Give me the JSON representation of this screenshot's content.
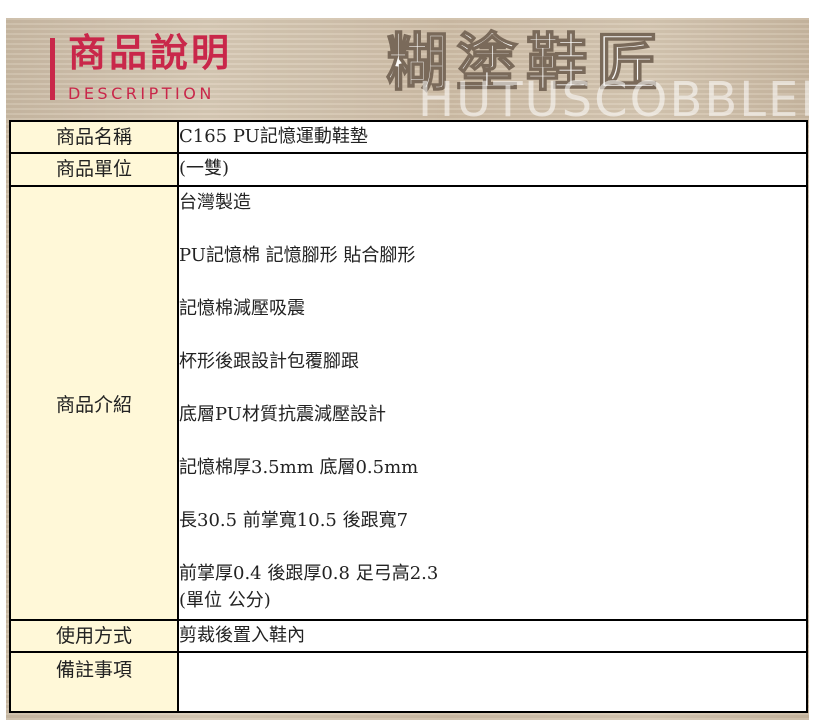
{
  "header": {
    "title_cn": "商品說明",
    "title_en": "DESCRIPTION",
    "brand_cn": "糊塗鞋匠",
    "brand_en": "HUTUSCOBBLER"
  },
  "table": {
    "rows": [
      {
        "label": "商品名稱",
        "value": "C165 PU記憶運動鞋墊"
      },
      {
        "label": "商品單位",
        "value": "(一雙)"
      },
      {
        "label": "商品介紹",
        "lines": [
          "台灣製造",
          "PU記憶棉 記憶腳形 貼合腳形",
          "記憶棉減壓吸震",
          "杯形後跟設計包覆腳跟",
          "底層PU材質抗震減壓設計",
          "記憶棉厚3.5mm 底層0.5mm",
          "長30.5 前掌寬10.5 後跟寬7",
          "前掌厚0.4 後跟厚0.8 足弓高2.3",
          "(單位 公分)"
        ]
      },
      {
        "label": "使用方式",
        "value": "剪裁後置入鞋內"
      },
      {
        "label": "備註事項",
        "value": ""
      }
    ]
  }
}
